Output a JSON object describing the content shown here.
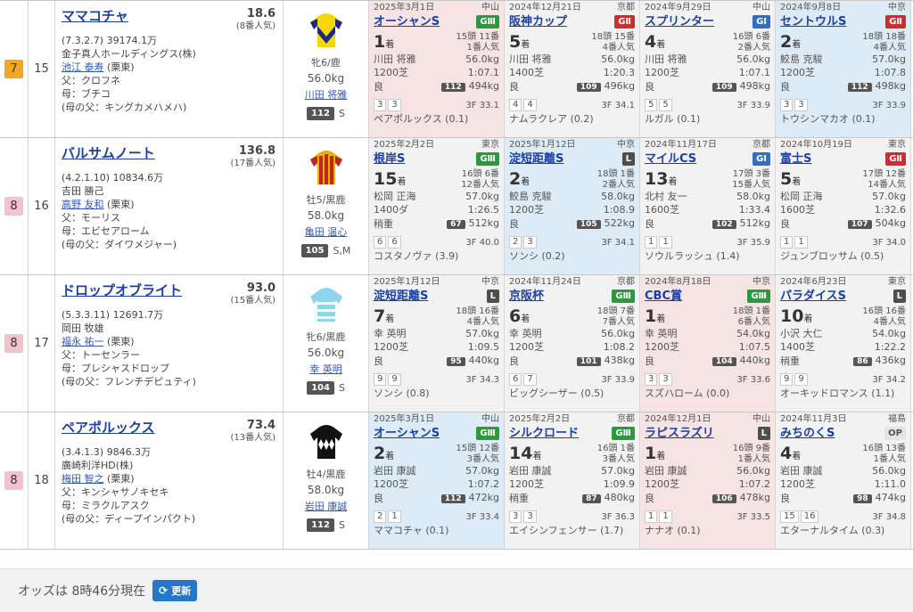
{
  "rows": [
    {
      "waku": "7",
      "waku_color": "#f5a623",
      "umaban": "15",
      "name": "ママコチャ",
      "odds": "18.6",
      "popular": "(8番人気)",
      "record": "(7.3.2.7)",
      "prize": "39174.1万",
      "owner": "金子真人ホールディングス(株)",
      "trainer": "池江 泰寿",
      "trainer_loc": "(栗東)",
      "sire": "父：クロフネ",
      "dam": "母：ブチコ",
      "damsire": "(母の父：キングカメハメハ)",
      "sex_age": "牝6/鹿",
      "weight": "56.0kg",
      "jockey": "川田 将雅",
      "score": "112",
      "score_label": "S",
      "races": [
        {
          "bg": "red",
          "date": "2025年3月1日",
          "venue": "中山",
          "name": "オーシャンS",
          "grade": "GⅢ",
          "grade_cls": "g3",
          "rank": "1",
          "field": "15頭 11番",
          "pop": "1番人気",
          "jockey": "川田 将雅",
          "kg": "56.0kg",
          "course": "1200芝",
          "time": "1:07.1",
          "cond": "良",
          "hb": "112",
          "bw": "494kg",
          "pos": [
            "3",
            "3"
          ],
          "f3": "3F 33.1",
          "winner": "ペアポルックス (0.1)"
        },
        {
          "bg": "gray",
          "date": "2024年12月21日",
          "venue": "京都",
          "name": "阪神カップ",
          "grade": "GⅡ",
          "grade_cls": "g2",
          "rank": "5",
          "field": "18頭 15番",
          "pop": "4番人気",
          "jockey": "川田 将雅",
          "kg": "56.0kg",
          "course": "1400芝",
          "time": "1:20.3",
          "cond": "良",
          "hb": "109",
          "bw": "496kg",
          "pos": [
            "4",
            "4"
          ],
          "f3": "3F 34.1",
          "winner": "ナムラクレア (0.2)"
        },
        {
          "bg": "gray",
          "date": "2024年9月29日",
          "venue": "中山",
          "name": "スプリンター",
          "grade": "GⅠ",
          "grade_cls": "g1",
          "rank": "4",
          "field": "16頭 6番",
          "pop": "2番人気",
          "jockey": "川田 将雅",
          "kg": "56.0kg",
          "course": "1200芝",
          "time": "1:07.1",
          "cond": "良",
          "hb": "109",
          "bw": "498kg",
          "pos": [
            "5",
            "5"
          ],
          "f3": "3F 33.9",
          "winner": "ルガル (0.1)"
        },
        {
          "bg": "blue",
          "date": "2024年9月8日",
          "venue": "中京",
          "name": "セントウルS",
          "grade": "GⅡ",
          "grade_cls": "g2",
          "rank": "2",
          "field": "18頭 18番",
          "pop": "4番人気",
          "jockey": "鮫島 克駿",
          "kg": "57.0kg",
          "course": "1200芝",
          "time": "1:07.8",
          "cond": "良",
          "hb": "112",
          "bw": "498kg",
          "pos": [
            "3",
            "3"
          ],
          "f3": "3F 33.9",
          "winner": "トウシンマカオ (0.1)"
        }
      ]
    },
    {
      "waku": "8",
      "waku_color": "#f4c2cc",
      "umaban": "16",
      "name": "バルサムノート",
      "odds": "136.8",
      "popular": "(17番人気)",
      "record": "(4.2.1.10)",
      "prize": "10834.6万",
      "owner": "吉田 勝己",
      "trainer": "高野 友和",
      "trainer_loc": "(栗東)",
      "sire": "父：モーリス",
      "dam": "母：エビセアローム",
      "damsire": "(母の父：ダイワメジャー)",
      "sex_age": "牡5/黒鹿",
      "weight": "58.0kg",
      "jockey": "亀田 温心",
      "score": "105",
      "score_label": "S,M",
      "races": [
        {
          "bg": "gray",
          "date": "2025年2月2日",
          "venue": "東京",
          "name": "根岸S",
          "grade": "GⅢ",
          "grade_cls": "g3",
          "rank": "15",
          "field": "16頭 6番",
          "pop": "12番人気",
          "jockey": "松岡 正海",
          "kg": "57.0kg",
          "course": "1400ダ",
          "time": "1:26.5",
          "cond": "稍重",
          "hb": "67",
          "bw": "512kg",
          "pos": [
            "6",
            "6"
          ],
          "f3": "3F 40.0",
          "winner": "コスタノヴァ (3.9)"
        },
        {
          "bg": "blue",
          "date": "2025年1月12日",
          "venue": "中京",
          "name": "淀短距離S",
          "grade": "L",
          "grade_cls": "gl",
          "rank": "2",
          "field": "18頭 1番",
          "pop": "2番人気",
          "jockey": "鮫島 克駿",
          "kg": "58.0kg",
          "course": "1200芝",
          "time": "1:08.9",
          "cond": "良",
          "hb": "105",
          "bw": "522kg",
          "pos": [
            "2",
            "3"
          ],
          "f3": "3F 34.1",
          "winner": "ソンシ (0.2)"
        },
        {
          "bg": "gray",
          "date": "2024年11月17日",
          "venue": "京都",
          "name": "マイルCS",
          "grade": "GⅠ",
          "grade_cls": "g1",
          "rank": "13",
          "field": "17頭 3番",
          "pop": "15番人気",
          "jockey": "北村 友一",
          "kg": "58.0kg",
          "course": "1600芝",
          "time": "1:33.4",
          "cond": "良",
          "hb": "102",
          "bw": "512kg",
          "pos": [
            "1",
            "1"
          ],
          "f3": "3F 35.9",
          "winner": "ソウルラッシュ (1.4)"
        },
        {
          "bg": "gray",
          "date": "2024年10月19日",
          "venue": "東京",
          "name": "富士S",
          "grade": "GⅡ",
          "grade_cls": "g2",
          "rank": "5",
          "field": "17頭 12番",
          "pop": "14番人気",
          "jockey": "松岡 正海",
          "kg": "57.0kg",
          "course": "1600芝",
          "time": "1:32.6",
          "cond": "良",
          "hb": "107",
          "bw": "504kg",
          "pos": [
            "1",
            "1"
          ],
          "f3": "3F 34.0",
          "winner": "ジュンブロッサム (0.5)"
        }
      ]
    },
    {
      "waku": "8",
      "waku_color": "#f4c2cc",
      "umaban": "17",
      "name": "ドロップオブライト",
      "odds": "93.0",
      "popular": "(15番人気)",
      "record": "(5.3.3.11)",
      "prize": "12691.7万",
      "owner": "岡田 牧雄",
      "trainer": "福永 祐一",
      "trainer_loc": "(栗東)",
      "sire": "父：トーセンラー",
      "dam": "母：プレシャスドロップ",
      "damsire": "(母の父：フレンチデピュティ)",
      "sex_age": "牝6/黒鹿",
      "weight": "56.0kg",
      "jockey": "幸 英明",
      "score": "104",
      "score_label": "S",
      "races": [
        {
          "bg": "gray",
          "date": "2025年1月12日",
          "venue": "中京",
          "name": "淀短距離S",
          "grade": "L",
          "grade_cls": "gl",
          "rank": "7",
          "field": "18頭 16番",
          "pop": "4番人気",
          "jockey": "幸 英明",
          "kg": "57.0kg",
          "course": "1200芝",
          "time": "1:09.5",
          "cond": "良",
          "hb": "95",
          "bw": "440kg",
          "pos": [
            "9",
            "9"
          ],
          "f3": "3F 34.3",
          "winner": "ソンシ (0.8)"
        },
        {
          "bg": "gray",
          "date": "2024年11月24日",
          "venue": "京都",
          "name": "京阪杯",
          "grade": "GⅢ",
          "grade_cls": "g3",
          "rank": "6",
          "field": "18頭 7番",
          "pop": "7番人気",
          "jockey": "幸 英明",
          "kg": "56.0kg",
          "course": "1200芝",
          "time": "1:08.2",
          "cond": "良",
          "hb": "101",
          "bw": "438kg",
          "pos": [
            "6",
            "7"
          ],
          "f3": "3F 33.9",
          "winner": "ビッグシーザー (0.5)"
        },
        {
          "bg": "red",
          "date": "2024年8月18日",
          "venue": "中京",
          "name": "CBC賞",
          "grade": "GⅢ",
          "grade_cls": "g3",
          "rank": "1",
          "field": "18頭 1番",
          "pop": "6番人気",
          "jockey": "幸 英明",
          "kg": "54.0kg",
          "course": "1200芝",
          "time": "1:07.5",
          "cond": "良",
          "hb": "104",
          "bw": "440kg",
          "pos": [
            "3",
            "3"
          ],
          "f3": "3F 33.6",
          "winner": "スズハローム (0.0)"
        },
        {
          "bg": "gray",
          "date": "2024年6月23日",
          "venue": "東京",
          "name": "パラダイスS",
          "grade": "L",
          "grade_cls": "gl",
          "rank": "10",
          "field": "16頭 16番",
          "pop": "4番人気",
          "jockey": "小沢 大仁",
          "kg": "54.0kg",
          "course": "1400芝",
          "time": "1:22.2",
          "cond": "稍重",
          "hb": "86",
          "bw": "436kg",
          "pos": [
            "9",
            "9"
          ],
          "f3": "3F 34.2",
          "winner": "オーキッドロマンス (1.1)"
        }
      ]
    },
    {
      "waku": "8",
      "waku_color": "#f4c2cc",
      "umaban": "18",
      "name": "ペアポルックス",
      "odds": "73.4",
      "popular": "(13番人気)",
      "record": "(3.4.1.3)",
      "prize": "9846.3万",
      "owner": "廣崎利洋HD(株)",
      "trainer": "梅田 智之",
      "trainer_loc": "(栗東)",
      "sire": "父：キンシャサノキセキ",
      "dam": "母：ミラクルアスク",
      "damsire": "(母の父：ディープインパクト)",
      "sex_age": "牡4/黒鹿",
      "weight": "58.0kg",
      "jockey": "岩田 康誠",
      "score": "112",
      "score_label": "S",
      "races": [
        {
          "bg": "blue",
          "date": "2025年3月1日",
          "venue": "中山",
          "name": "オーシャンS",
          "grade": "GⅢ",
          "grade_cls": "g3",
          "rank": "2",
          "field": "15頭 12番",
          "pop": "3番人気",
          "jockey": "岩田 康誠",
          "kg": "57.0kg",
          "course": "1200芝",
          "time": "1:07.2",
          "cond": "良",
          "hb": "112",
          "bw": "472kg",
          "pos": [
            "2",
            "1"
          ],
          "f3": "3F 33.4",
          "winner": "ママコチャ (0.1)"
        },
        {
          "bg": "gray",
          "date": "2025年2月2日",
          "venue": "京都",
          "name": "シルクロード",
          "grade": "GⅢ",
          "grade_cls": "g3",
          "rank": "14",
          "field": "16頭 1番",
          "pop": "3番人気",
          "jockey": "岩田 康誠",
          "kg": "57.0kg",
          "course": "1200芝",
          "time": "1:09.9",
          "cond": "稍重",
          "hb": "87",
          "bw": "480kg",
          "pos": [
            "3",
            "3"
          ],
          "f3": "3F 36.3",
          "winner": "エイシンフェンサー (1.7)"
        },
        {
          "bg": "red",
          "date": "2024年12月1日",
          "venue": "中山",
          "name": "ラピスラズリ",
          "grade": "L",
          "grade_cls": "gl",
          "rank": "1",
          "field": "16頭 9番",
          "pop": "1番人気",
          "jockey": "岩田 康誠",
          "kg": "56.0kg",
          "course": "1200芝",
          "time": "1:07.2",
          "cond": "良",
          "hb": "106",
          "bw": "478kg",
          "pos": [
            "1",
            "1"
          ],
          "f3": "3F 33.5",
          "winner": "ナナオ (0.1)"
        },
        {
          "bg": "gray",
          "date": "2024年11月3日",
          "venue": "福島",
          "name": "みちのくS",
          "grade": "OP",
          "grade_cls": "gop",
          "rank": "4",
          "field": "16頭 13番",
          "pop": "1番人気",
          "jockey": "岩田 康誠",
          "kg": "56.0kg",
          "course": "1200芝",
          "time": "1:11.0",
          "cond": "良",
          "hb": "98",
          "bw": "474kg",
          "pos": [
            "15",
            "16"
          ],
          "f3": "3F 34.8",
          "winner": "エターナルタイム (0.3)"
        }
      ]
    }
  ],
  "rank_suffix": "着",
  "footer": {
    "text": "オッズは 8時46分現在",
    "button": "更新",
    "button_icon": "refresh-icon"
  }
}
